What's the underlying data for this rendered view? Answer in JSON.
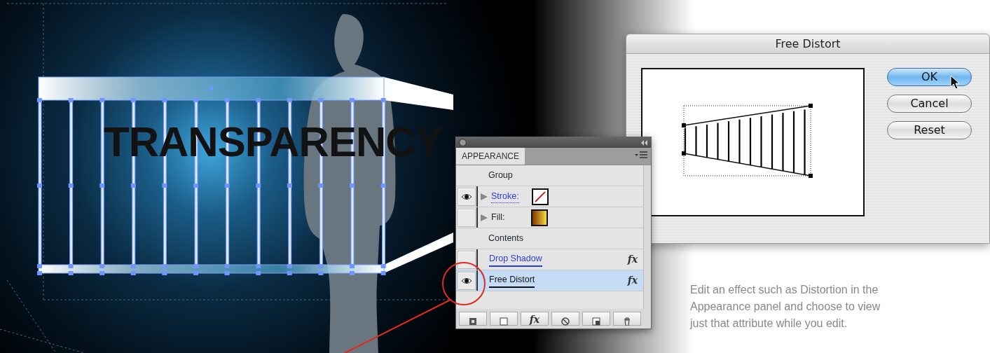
{
  "artwork": {
    "text": "TRANSPARENCY"
  },
  "dialog": {
    "title": "Free Distort",
    "buttons": [
      {
        "label": "OK",
        "default": true
      },
      {
        "label": "Cancel",
        "default": false
      },
      {
        "label": "Reset",
        "default": false
      }
    ]
  },
  "panel": {
    "tab": "APPEARANCE",
    "rows": [
      {
        "kind": "header",
        "label": "Group",
        "selected": false
      },
      {
        "kind": "attribute",
        "label": "Stroke:",
        "visible": true,
        "link": true,
        "swatch": {
          "kind": "none"
        },
        "selected": false
      },
      {
        "kind": "attribute",
        "label": "Fill:",
        "visible": false,
        "link": false,
        "swatch": {
          "kind": "gradient"
        },
        "selected": false
      },
      {
        "kind": "header",
        "label": "Contents",
        "selected": false
      },
      {
        "kind": "effect",
        "label": "Drop Shadow",
        "visible": false,
        "link": true,
        "icon_text": "fx",
        "selected": false
      },
      {
        "kind": "effect",
        "label": "Free Distort",
        "visible": true,
        "link": false,
        "icon_text": "fx",
        "selected": true
      }
    ],
    "effect_button": "fx"
  },
  "caption": "Edit an effect such as Distortion in the Appearance panel and choose to view just that attribute while you edit."
}
